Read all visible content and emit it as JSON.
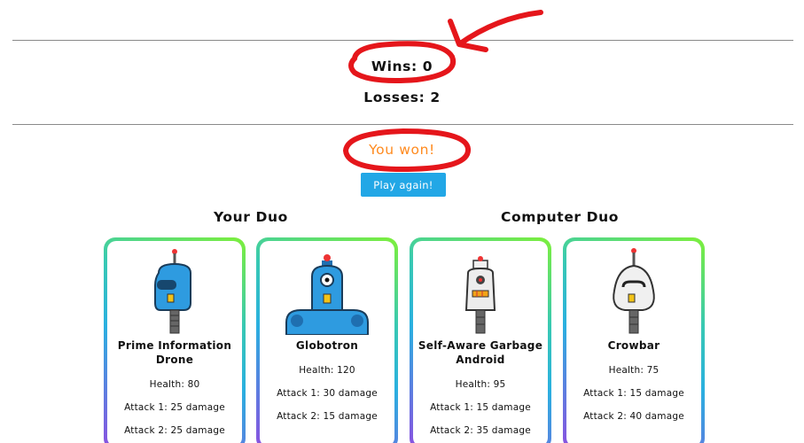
{
  "score": {
    "wins": "Wins: 0",
    "losses": "Losses: 2"
  },
  "result_text": "You won!",
  "play_again_label": "Play again!",
  "sections": {
    "yours": "Your Duo",
    "computer": "Computer Duo"
  },
  "cards": [
    {
      "name": "Prime Information Drone",
      "health": "Health: 80",
      "attack1": "Attack 1: 25 damage",
      "attack2": "Attack 2: 25 damage"
    },
    {
      "name": "Globotron",
      "health": "Health: 120",
      "attack1": "Attack 1: 30 damage",
      "attack2": "Attack 2: 15 damage"
    },
    {
      "name": "Self-Aware Garbage Android",
      "health": "Health: 95",
      "attack1": "Attack 1: 15 damage",
      "attack2": "Attack 2: 35 damage"
    },
    {
      "name": "Crowbar",
      "health": "Health: 75",
      "attack1": "Attack 1: 15 damage",
      "attack2": "Attack 2: 40 damage"
    }
  ],
  "colors": {
    "accent_button": "#22a7e6",
    "result": "#ff8a1e",
    "annotation": "#e5161b"
  }
}
